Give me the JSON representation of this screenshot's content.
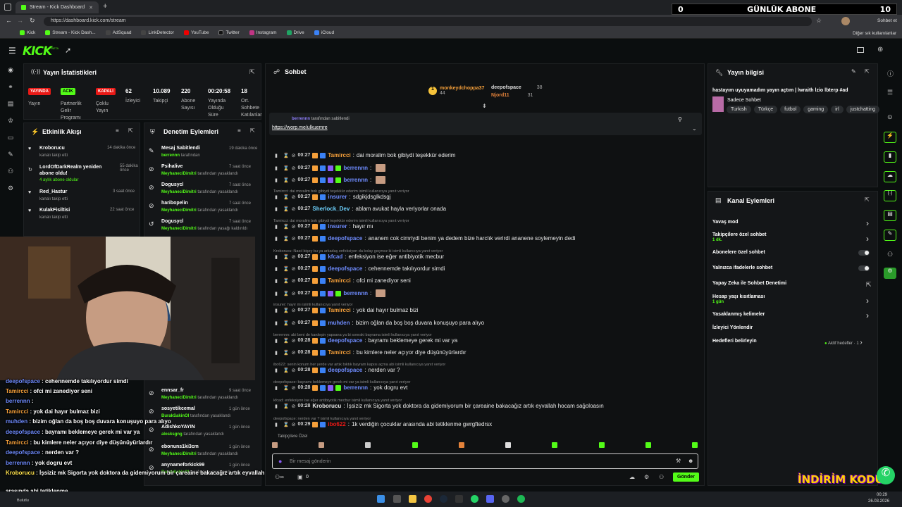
{
  "browser": {
    "tabs": [
      {
        "title": "Stream - Kick Dashboard"
      }
    ],
    "url": "https://dashboard.kick.com/stream",
    "profile_label": "Sohbet et",
    "bookmarks": [
      "Kick",
      "Stream - Kick Dash...",
      "AdSquad",
      "LinkDetector",
      "YouTube",
      "Twitter",
      "Instagram",
      "Drive",
      "iCloud"
    ],
    "other_bookmarks": "Diğer sık kullanılanlar"
  },
  "overlay_sub_counter": {
    "count": "0",
    "label": "GÜNLÜK ABONE",
    "goal": "10"
  },
  "kick": {
    "logo": "KICK",
    "beta": "BETA"
  },
  "stats": {
    "title": "Yayın İstatistikleri",
    "items": [
      {
        "value": "YAYINDA",
        "label": "Yayın",
        "color": "#e91916"
      },
      {
        "value": "ACIK",
        "label": "Partnerlik Gelir Programı",
        "color": "#53fc18"
      },
      {
        "value": "KAPALI",
        "label": "Çoklu Yayın",
        "color": "#e91916"
      },
      {
        "value": "62",
        "label": "İzleyici"
      },
      {
        "value": "10.089",
        "label": "Takipçi"
      },
      {
        "value": "220",
        "label": "Abone Sayısı"
      },
      {
        "value": "00:20:58",
        "label": "Yayında Olduğu Süre"
      },
      {
        "value": "18",
        "label": "Ort. Sohbete Katılanlar"
      }
    ]
  },
  "activity": {
    "title": "Etkinlik Akışı",
    "items": [
      {
        "name": "Kroborucu",
        "sub": "kanalı takip etti",
        "time": "14 dakika önce"
      },
      {
        "name": "LordOfDarkRealm yeniden abone oldu!",
        "sub": "4 aylık abone oldular",
        "time": "55 dakika önce"
      },
      {
        "name": "Red_Hastur",
        "sub": "kanalı takip etti",
        "time": "3 saat önce"
      },
      {
        "name": "KulakFisiltisi",
        "sub": "kanalı takip etti",
        "time": "22 saat önce"
      }
    ]
  },
  "moderation": {
    "title": "Denetim Eylemleri",
    "items": [
      {
        "name": "Mesaj Sabitlendi",
        "by": "berrennn",
        "suffix": "tarafından",
        "time": "19 dakika önce"
      },
      {
        "name": "Psihalive",
        "by": "MeyhaneciDimitri",
        "suffix": "tarafından yasaklandı",
        "time": "7 saat önce"
      },
      {
        "name": "Dogusycl",
        "by": "MeyhaneciDimitri",
        "suffix": "tarafından yasaklandı",
        "time": "7 saat önce"
      },
      {
        "name": "haribopelin",
        "by": "MeyhaneciDimitri",
        "suffix": "tarafından yasaklandı",
        "time": "7 saat önce"
      },
      {
        "name": "Dogusycl",
        "by": "MeyhaneciDimitri",
        "suffix": "tarafından yasağı kaldırıldı",
        "time": "7 saat önce"
      },
      {
        "name": "ennsar_fr",
        "by": "MeyhaneciDimitri",
        "suffix": "tarafından yasaklandı",
        "time": "9 saat önce"
      },
      {
        "name": "sosyetikcemal",
        "by": "BurakSakinOl",
        "suffix": "tarafından yasaklandı",
        "time": "1 gün önce"
      },
      {
        "name": "AdishkoYAYIN",
        "by": "alosksgng",
        "suffix": "tarafından yasaklandı",
        "time": "1 gün önce"
      },
      {
        "name": "ebonuns1ki3cm",
        "by": "MeyhaneciDimitri",
        "suffix": "tarafından yasaklandı",
        "time": "1 gün önce"
      },
      {
        "name": "anynameforkick99",
        "by": "BurakSakinOl",
        "suffix": "tarafından yasaklandı",
        "time": "1 gün önce"
      }
    ]
  },
  "chat": {
    "title": "Sohbet",
    "top_gifters": [
      {
        "name": "monkeydchoppa37",
        "count": "44"
      },
      {
        "name": "deepofspace",
        "count": "38"
      },
      {
        "name": "Njord11",
        "count": "31"
      }
    ],
    "pinned": {
      "by": "berrennn",
      "by_suffix": "tarafından sabitlendi",
      "text": "https://worp.me/ulkuemre"
    },
    "messages": [
      {
        "reply": "",
        "time": "00:27",
        "user": "Tamircci",
        "color": "#f6a03a",
        "text": "dai moralim bok gibiydi teşekkür ederim"
      },
      {
        "reply": "",
        "time": "00:27",
        "user": "berrennn",
        "color": "#6f8cff",
        "text": ""
      },
      {
        "reply": "",
        "time": "00:27",
        "user": "berrennn",
        "color": "#6f8cff",
        "text": ""
      },
      {
        "reply": "Tamircci: dai moralim bok gibiydi teşekkür ederim isimli kullanıcıya yanıt veriyor",
        "time": "00:27",
        "user": "insurer",
        "color": "#6f8cff",
        "text": "sdgikjdsglkdsgj"
      },
      {
        "reply": "",
        "time": "00:27",
        "user": "Sherlock_Dev",
        "color": "#6fd3ff",
        "text": "ablam avukat hayla veriyorlar onada"
      },
      {
        "reply": "Tamircci: dai moralim bok gibiydi teşekkür ederim isimli kullanıcıya yanıt veriyor",
        "time": "00:27",
        "user": "insurer",
        "color": "#6f8cff",
        "text": "hayır mı"
      },
      {
        "reply": "",
        "time": "00:27",
        "user": "deepofspace",
        "color": "#6f8cff",
        "text": "ananem cok cimriydi benim ya dedem bize harclık verirdi ananene soylemeyin dedi"
      },
      {
        "reply": "Kroborucu: Nasıl bişey bu ya arkadaş enfeksiyon da kolay geçmez ki isimli kullanıcıya yanıt veriyor",
        "time": "00:27",
        "user": "kfcad",
        "color": "#6f8cff",
        "text": "enfeksiyon ise eğer antibiyotik mecbur"
      },
      {
        "reply": "",
        "time": "00:27",
        "user": "deepofspace",
        "color": "#6f8cff",
        "text": "cehennemde takılıyordur simdi"
      },
      {
        "reply": "",
        "time": "00:27",
        "user": "Tamircci",
        "color": "#f6a03a",
        "text": "ofci mi zanediyor seni"
      },
      {
        "reply": "",
        "time": "00:27",
        "user": "berrennn",
        "color": "#6f8cff",
        "text": ""
      },
      {
        "reply": "insurer: hayır mı isimli kullanıcıya yanıt veriyor",
        "time": "00:27",
        "user": "Tamircci",
        "color": "#f6a03a",
        "text": "yok dai hayır bulmaz bizi"
      },
      {
        "reply": "",
        "time": "00:27",
        "user": "muhden",
        "color": "#6f8cff",
        "text": "bizim oğlan da boş boş duvara konuşuyo para alıyo"
      },
      {
        "reply": "berrennn: abi beni de kardeşin yapsana ya bi sonraki bayrama isimli kullanıcıya yanıt veriyor",
        "time": "00:28",
        "user": "deepofspace",
        "color": "#6f8cff",
        "text": "bayramı beklemeye gerek mi var ya"
      },
      {
        "reply": "",
        "time": "00:28",
        "user": "Tamircci",
        "color": "#f6a03a",
        "text": "bu kimlere neler açıyor diye düşünüyürlardır"
      },
      {
        "reply": "ibo622: senin konum her yerde var artık bıktık bayram kapısı açma abi isimli kullanıcıya yanıt veriyor",
        "time": "00:28",
        "user": "deepofspace",
        "color": "#6f8cff",
        "text": "nerden var ?"
      },
      {
        "reply": "deepofspace: bayramı beklemeye gerek mi var ya isimli kullanıcıya yanıt veriyor",
        "time": "00:28",
        "user": "berrennn",
        "color": "#6f8cff",
        "text": "yok dogru evt"
      },
      {
        "reply": "kfcad: enfeksiyon ise eğer antibiyotik mecbur isimli kullanıcıya yanıt veriyor",
        "time": "00:28",
        "user": "Kroborucu",
        "color": "#e6e6e6",
        "text": "İşsiziz mk Sigorta yok doktora da gidemiyorum bir çareaine bakacağız artık eyvallah hocam sağoloasın"
      },
      {
        "reply": "deepofspace: nerden var ? isimli kullanıcıya yanıt veriyor",
        "time": "00:29",
        "user": "ibo622",
        "color": "#e91916",
        "text": "1k verdiğin çocuklar arasında abi tetiklenme gwrgftedrsx"
      }
    ],
    "followers_only": "Takipçilere Özel",
    "input_placeholder": "Bir mesaj gönderin",
    "send_label": "Gönder",
    "points": "0"
  },
  "stream_info": {
    "title": "Yayın bilgisi",
    "stream_title": "hastayım uyuyamadım yayın açtım | lwraith lzio lbterp #ad",
    "category": "Sadece Sohbet",
    "tags": [
      "Turkish",
      "Türkçe",
      "futbol",
      "gaming",
      "irl",
      "justchatting"
    ]
  },
  "channel_actions": {
    "title": "Kanal Eylemleri",
    "items": [
      {
        "label": "Yavaş mod",
        "sub": "",
        "control": "chevron"
      },
      {
        "label": "Takipçilere özel sohbet",
        "sub": "1 dk.",
        "control": "chevron"
      },
      {
        "label": "Abonelere özel sohbet",
        "sub": "",
        "control": "toggle"
      },
      {
        "label": "Yalnızca ifadelerle sohbet",
        "sub": "",
        "control": "toggle"
      },
      {
        "label": "Yapay Zeka ile Sohbet Denetimi",
        "sub": "",
        "control": "external"
      },
      {
        "label": "Hesap yaşı kısıtlaması",
        "sub": "1 gün",
        "control": "chevron"
      },
      {
        "label": "Yasaklanmış kelimeler",
        "sub": "",
        "control": "chevron"
      },
      {
        "label": "İzleyici Yönlendir",
        "sub": "",
        "control": "none"
      },
      {
        "label": "Hedefleri belirleyin",
        "sub": "",
        "control": "goal",
        "goal_text": "Aktif hedefler · 1"
      }
    ]
  },
  "overlay_chat": [
    {
      "user": "deepofspace",
      "color": "#6f8cff",
      "text": "cehennemde takılıyordur simdi"
    },
    {
      "user": "Tamircci",
      "color": "#f6a03a",
      "text": "ofci mi zanediyor seni"
    },
    {
      "user": "berrennn",
      "color": "#6f8cff",
      "text": ""
    },
    {
      "user": "Tamircci",
      "color": "#f6a03a",
      "text": "yok dai hayır bulmaz bizi"
    },
    {
      "user": "muhden",
      "color": "#6f8cff",
      "text": "bizim oğlan da boş boş duvara konuşuyo para alıyo"
    },
    {
      "user": "deepofspace",
      "color": "#6f8cff",
      "text": "bayramı beklemeye gerek mi var ya"
    },
    {
      "user": "Tamircci",
      "color": "#f6a03a",
      "text": "bu kimlere neler açıyor diye düşünüyürlardır"
    },
    {
      "user": "deepofspace",
      "color": "#6f8cff",
      "text": "nerden var ?"
    },
    {
      "user": "berrennn",
      "color": "#6f8cff",
      "text": "yok dogru evt"
    },
    {
      "user": "Kroborucu",
      "color": "#ffe34d",
      "text": "İşsiziz mk Sigorta yok doktora da gidemiyorum bir çareaine bakacağız artık eyvallah hocam sağoloasın"
    },
    {
      "user": "",
      "color": "#ffffff",
      "text": "arasında abi tetiklenme"
    }
  ],
  "promo_overlay": "İNDİRİM KODU",
  "taskbar": {
    "time": "00:29",
    "date": "26.03.2026",
    "weather": "Bulutlu"
  }
}
